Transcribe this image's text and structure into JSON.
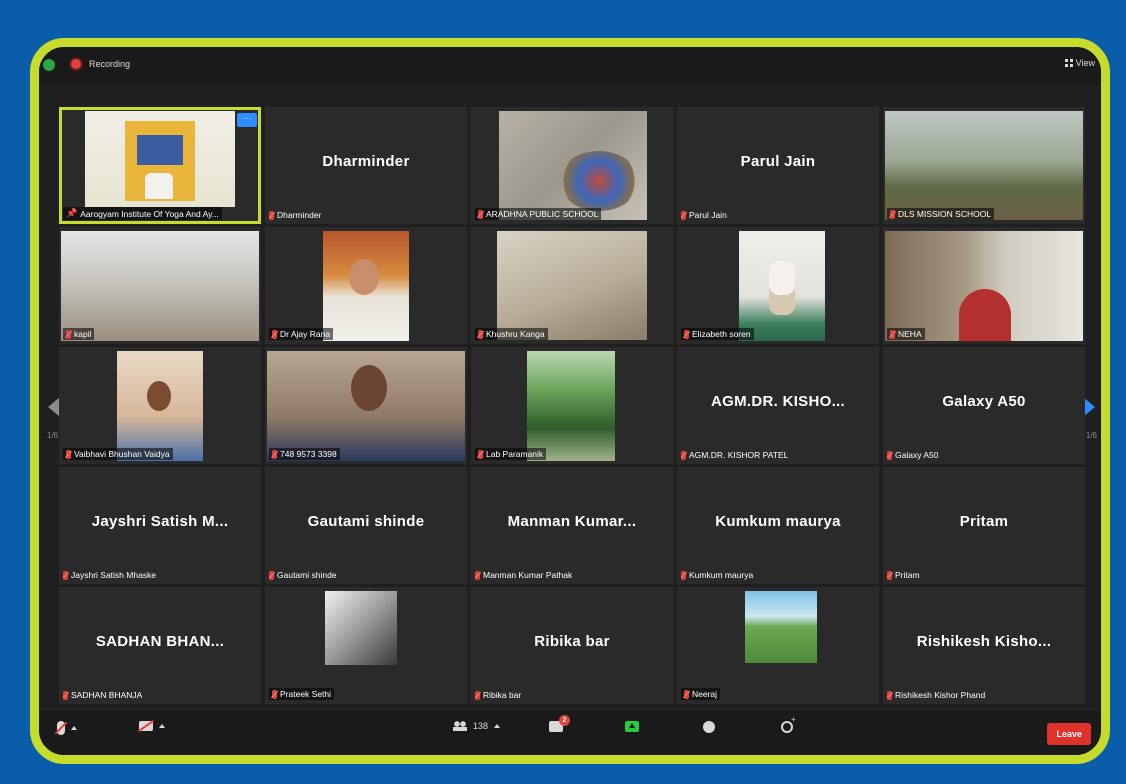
{
  "topbar": {
    "recording_label": "Recording",
    "view_label": "View"
  },
  "pagination": {
    "left": "1/6",
    "right": "1/6"
  },
  "tiles": [
    {
      "label": "Aarogyam Institute Of Yoga And Ay...",
      "big": "",
      "video": "poster",
      "active": true
    },
    {
      "label": "Dharminder",
      "big": "Dharminder",
      "video": ""
    },
    {
      "label": "ARADHNA PUBLIC SCHOOL",
      "big": "",
      "video": "kids"
    },
    {
      "label": "Parul Jain",
      "big": "Parul Jain",
      "video": ""
    },
    {
      "label": "DLS MISSION SCHOOL",
      "big": "",
      "video": "trees"
    },
    {
      "label": "kapil",
      "big": "",
      "video": "group"
    },
    {
      "label": "Dr Ajay Rana",
      "big": "",
      "video": "man"
    },
    {
      "label": "Khushru Kanga",
      "big": "",
      "video": "room"
    },
    {
      "label": "Elizabeth soren",
      "big": "",
      "video": "yoga"
    },
    {
      "label": "NEHA",
      "big": "",
      "video": "neha"
    },
    {
      "label": "Vaibhavi Bhushan Vaidya",
      "big": "",
      "video": "vaib"
    },
    {
      "label": "748 9573 3398",
      "big": "",
      "video": "girl"
    },
    {
      "label": "Lab Paramanik",
      "big": "",
      "video": "park"
    },
    {
      "label": "AGM.DR. KISHOR PATEL",
      "big": "AGM.DR.  KISHO...",
      "video": ""
    },
    {
      "label": "Galaxy A50",
      "big": "Galaxy A50",
      "video": ""
    },
    {
      "label": "Jayshri Satish Mhaske",
      "big": "Jayshri  Satish  M...",
      "video": ""
    },
    {
      "label": "Gautami shinde",
      "big": "Gautami shinde",
      "video": ""
    },
    {
      "label": "Manman Kumar Pathak",
      "big": "Manman  Kumar...",
      "video": ""
    },
    {
      "label": "Kumkum maurya",
      "big": "Kumkum maurya",
      "video": ""
    },
    {
      "label": "Pritam",
      "big": "Pritam",
      "video": ""
    },
    {
      "label": "SADHAN BHANJA",
      "big": "SADHAN  BHAN...",
      "video": ""
    },
    {
      "label": "Prateek Sethi",
      "big": "",
      "video": "bw"
    },
    {
      "label": "Ribika bar",
      "big": "Ribika bar",
      "video": ""
    },
    {
      "label": "Neeraj",
      "big": "",
      "video": "field"
    },
    {
      "label": "Rishikesh Kishor Phand",
      "big": "Rishikesh  Kisho...",
      "video": ""
    }
  ],
  "bottombar": {
    "participants_count": "138",
    "chat_badge": "2",
    "leave_label": "Leave"
  }
}
